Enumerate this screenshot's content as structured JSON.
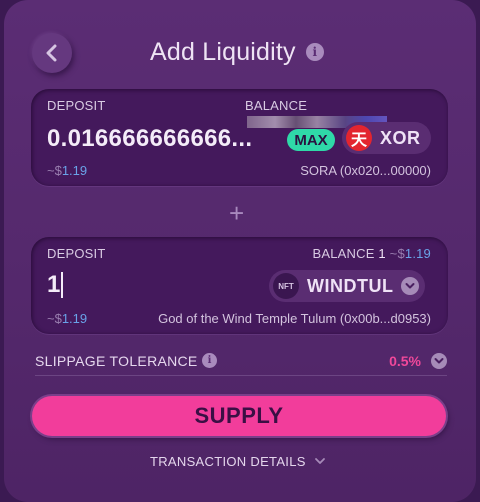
{
  "header": {
    "title": "Add Liquidity",
    "back_icon": "chevron-left-icon",
    "info_icon": "info-icon"
  },
  "deposit1": {
    "label": "DEPOSIT",
    "balance_label": "BALANCE",
    "amount": "0.016666666666...",
    "max_label": "MAX",
    "token_symbol": "XOR",
    "token_logo_glyph": "天",
    "fiat_prefix": "~$",
    "fiat_value": "1.19",
    "token_full": "SORA (0x020...00000)"
  },
  "plus_sign": "+",
  "deposit2": {
    "label": "DEPOSIT",
    "balance_label": "BALANCE",
    "balance_value": "1",
    "balance_fiat_prefix": "~$",
    "balance_fiat_value": "1.19",
    "amount": "1",
    "token_logo_text": "NFT",
    "token_symbol": "WINDTUL",
    "fiat_prefix": "~$",
    "fiat_value": "1.19",
    "token_full": "God of the Wind Temple Tulum (0x00b...d0953)"
  },
  "slippage": {
    "label": "SLIPPAGE TOLERANCE",
    "value": "0.5%"
  },
  "supply_label": "SUPPLY",
  "transaction_details_label": "TRANSACTION DETAILS",
  "colors": {
    "background": "#3b1a52",
    "panel": "#5b2d74",
    "card": "#44195c",
    "accent_pink": "#f23d9b",
    "max_badge": "#2fd9a8",
    "fiat_blue": "#6aa3e8",
    "xor_red": "#e3252f"
  }
}
